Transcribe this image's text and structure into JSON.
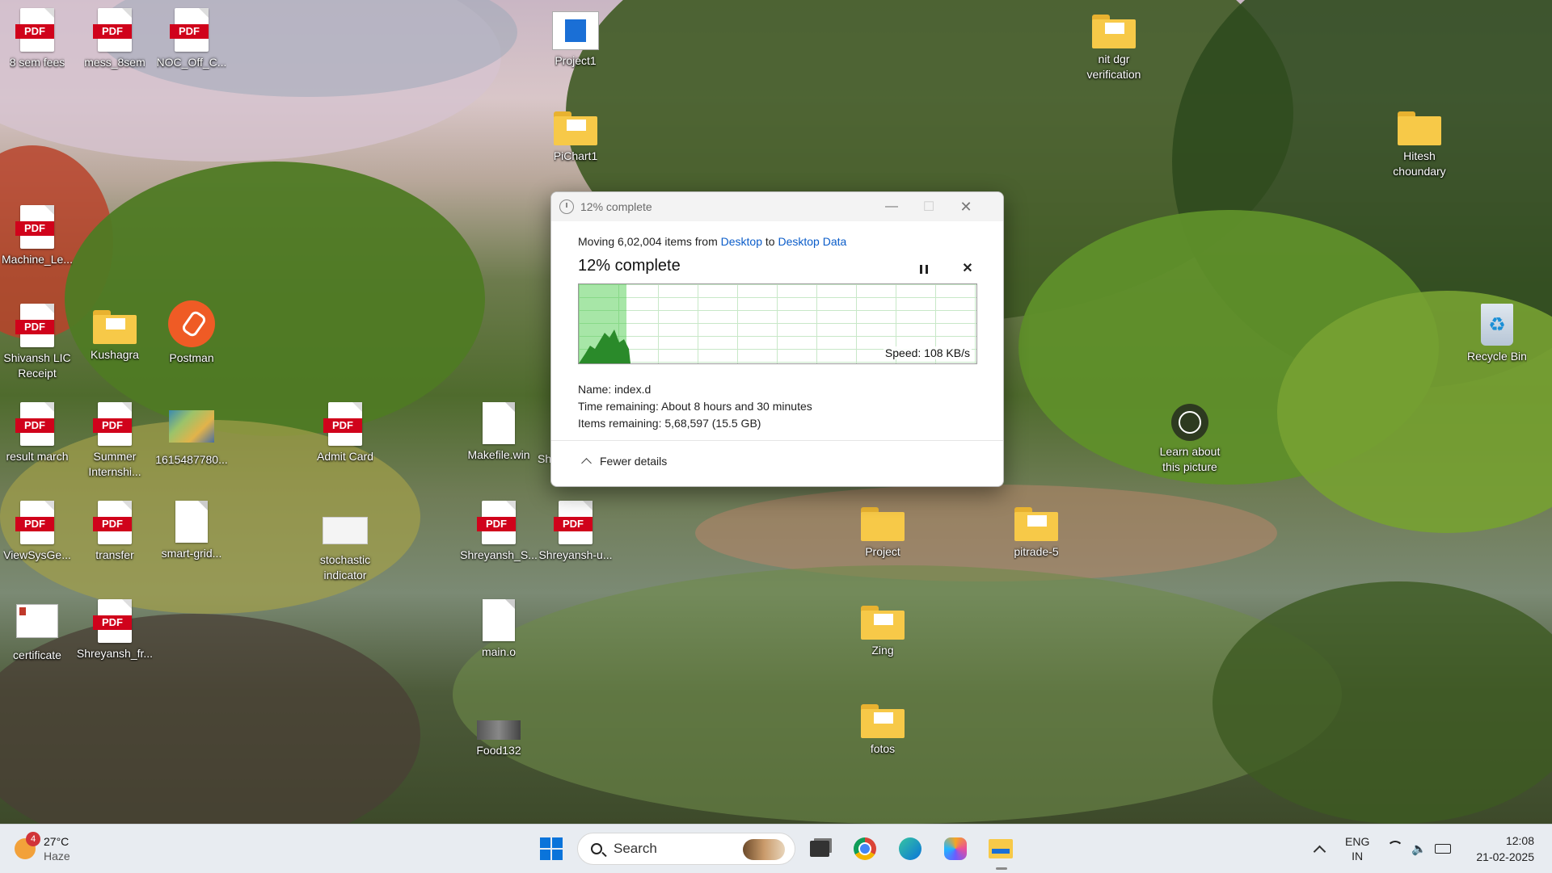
{
  "desktop_icons": [
    {
      "label": "8 sem fees",
      "type": "pdf"
    },
    {
      "label": "mess_8sem",
      "type": "pdf"
    },
    {
      "label": "NOC_Off_C...",
      "type": "pdf"
    },
    {
      "label": "Project1",
      "type": "app"
    },
    {
      "label": "nit dgr verification",
      "type": "folder"
    },
    {
      "label": "PiChart1",
      "type": "folder"
    },
    {
      "label": "Hitesh choundary",
      "type": "folder"
    },
    {
      "label": "Machine_Le...",
      "type": "pdf"
    },
    {
      "label": "Shivansh LIC Receipt",
      "type": "pdf"
    },
    {
      "label": "Kushagra",
      "type": "folder"
    },
    {
      "label": "Postman",
      "type": "app"
    },
    {
      "label": "Recycle Bin",
      "type": "app"
    },
    {
      "label": "result march",
      "type": "pdf"
    },
    {
      "label": "Summer Internshi...",
      "type": "pdf"
    },
    {
      "label": "1615487780...",
      "type": "image"
    },
    {
      "label": "Admit Card",
      "type": "pdf"
    },
    {
      "label": "Makefile.win",
      "type": "file"
    },
    {
      "label": "Sh",
      "type": "file"
    },
    {
      "label": "Learn about this picture",
      "type": "app"
    },
    {
      "label": "ViewSysGe...",
      "type": "pdf"
    },
    {
      "label": "transfer",
      "type": "pdf"
    },
    {
      "label": "smart-grid...",
      "type": "file"
    },
    {
      "label": "stochastic indicator",
      "type": "image"
    },
    {
      "label": "Shreyansh_S...",
      "type": "pdf"
    },
    {
      "label": "Shreyansh-u...",
      "type": "pdf"
    },
    {
      "label": "Project",
      "type": "folder"
    },
    {
      "label": "pitrade-5",
      "type": "folder"
    },
    {
      "label": "certificate",
      "type": "image"
    },
    {
      "label": "Shreyansh_fr...",
      "type": "pdf"
    },
    {
      "label": "main.o",
      "type": "file"
    },
    {
      "label": "Zing",
      "type": "folder"
    },
    {
      "label": "Food132",
      "type": "image"
    },
    {
      "label": "fotos",
      "type": "folder"
    }
  ],
  "dialog": {
    "title": "12% complete",
    "moving_prefix": "Moving 6,02,004 items from",
    "source": "Desktop",
    "to": "to",
    "destination": "Desktop Data",
    "heading": "12% complete",
    "progress_fraction": 0.12,
    "speed": "Speed: 108 KB/s",
    "name": "Name:  index.d",
    "time_remaining": "Time remaining:  About 8 hours and 30 minutes",
    "items_remaining": "Items remaining:  5,68,597 (15.5 GB)",
    "fewer_details": "Fewer details",
    "minimize": "—",
    "maximize": "☐",
    "close": "✕",
    "cancel": "✕"
  },
  "taskbar": {
    "weather_badge": "4",
    "weather_temp": "27°C",
    "weather_desc": "Haze",
    "search_placeholder": "Search",
    "lang_top": "ENG",
    "lang_bottom": "IN",
    "time": "12:08",
    "date": "21-02-2025",
    "tray_chevron": "^"
  },
  "colors": {
    "accent": "#0a5cc9",
    "pdf_red": "#d0021b",
    "folder": "#f7c948",
    "graph_fill": "#3cc83c"
  }
}
